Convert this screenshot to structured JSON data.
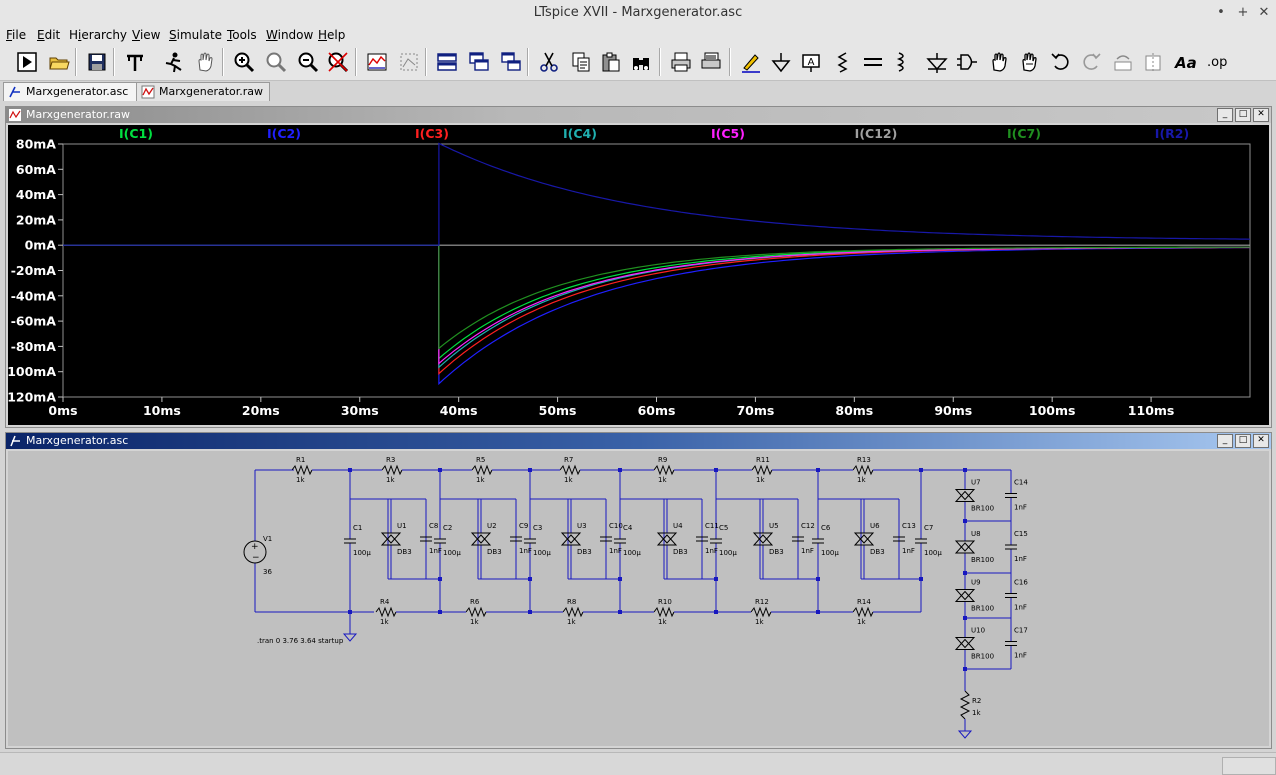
{
  "window": {
    "title": "LTspice XVII - Marxgenerator.asc",
    "controls": [
      "•",
      "+",
      "✕"
    ]
  },
  "menu": [
    "File",
    "Edit",
    "Hierarchy",
    "View",
    "Simulate",
    "Tools",
    "Window",
    "Help"
  ],
  "menu_mnemonics": [
    "F",
    "E",
    "i",
    "V",
    "S",
    "T",
    "W",
    "H"
  ],
  "toolbar": [
    "run-icon",
    "open-icon",
    "save-icon",
    "control-panel-icon",
    "halt-icon",
    "pan-hand-icon",
    "zoom-in-icon",
    "zoom-area-icon",
    "zoom-out-icon",
    "zoom-fit-icon",
    "autoscale-icon",
    "plot-settings-icon",
    "tile-horizontal-icon",
    "cascade-icon",
    "tile-vertical-icon",
    "cut-icon",
    "copy-icon",
    "paste-icon",
    "find-icon",
    "print-icon",
    "print-preview-icon",
    "draw-wire-icon",
    "ground-icon",
    "label-net-icon",
    "resistor-icon",
    "capacitor-icon",
    "inductor-icon",
    "diode-icon",
    "component-icon",
    "move-icon",
    "drag-icon",
    "undo-icon",
    "redo-icon",
    "rotate-icon",
    "mirror-icon",
    "text-icon",
    "spice-directive-icon"
  ],
  "tabs": [
    {
      "label": "Marxgenerator.asc",
      "active": true
    },
    {
      "label": "Marxgenerator.raw",
      "active": false
    }
  ],
  "plot_window": {
    "title": "Marxgenerator.raw",
    "buttons": [
      "_",
      "□",
      "✕"
    ]
  },
  "schematic_window": {
    "title": "Marxgenerator.asc",
    "buttons": [
      "_",
      "□",
      "✕"
    ]
  },
  "chart_data": {
    "type": "line",
    "background": "#000000",
    "x_ticks": [
      "0ms",
      "10ms",
      "20ms",
      "30ms",
      "40ms",
      "50ms",
      "60ms",
      "70ms",
      "80ms",
      "90ms",
      "100ms",
      "110ms"
    ],
    "y_ticks": [
      "80mA",
      "60mA",
      "40mA",
      "20mA",
      "0mA",
      "-20mA",
      "-40mA",
      "-60mA",
      "-80mA",
      "-100mA",
      "-120mA"
    ],
    "xlim": [
      0,
      120
    ],
    "ylim": [
      -120,
      80
    ],
    "x_unit": "ms",
    "y_unit": "mA",
    "trigger_ms": 38,
    "series": [
      {
        "name": "I(C1)",
        "color": "#00e040",
        "start": -88,
        "tau": 13
      },
      {
        "name": "I(C2)",
        "color": "#2020ff",
        "start": -108,
        "tau": 15
      },
      {
        "name": "I(C3)",
        "color": "#ff2020",
        "start": -100,
        "tau": 14
      },
      {
        "name": "I(C4)",
        "color": "#20b0b0",
        "start": -95,
        "tau": 13.5
      },
      {
        "name": "I(C5)",
        "color": "#ff20ff",
        "start": -92,
        "tau": 13.5
      },
      {
        "name": "I(C12)",
        "color": "#a0a0a0",
        "start": 0,
        "tau": 10
      },
      {
        "name": "I(C7)",
        "color": "#209020",
        "start": -80,
        "tau": 12.5
      },
      {
        "name": "I(R2)",
        "color": "#1818a8",
        "start": 77,
        "tau": 20
      }
    ]
  },
  "schematic": {
    "directive": ".tran 0 3.76 3.64 startup",
    "source": {
      "name": "V1",
      "value": "36"
    },
    "top_resistors": [
      {
        "name": "R1",
        "value": "1k"
      },
      {
        "name": "R3",
        "value": "1k"
      },
      {
        "name": "R5",
        "value": "1k"
      },
      {
        "name": "R7",
        "value": "1k"
      },
      {
        "name": "R9",
        "value": "1k"
      },
      {
        "name": "R11",
        "value": "1k"
      },
      {
        "name": "R13",
        "value": "1k"
      }
    ],
    "bottom_resistors": [
      {
        "name": "R4",
        "value": "1k"
      },
      {
        "name": "R6",
        "value": "1k"
      },
      {
        "name": "R8",
        "value": "1k"
      },
      {
        "name": "R10",
        "value": "1k"
      },
      {
        "name": "R12",
        "value": "1k"
      },
      {
        "name": "R14",
        "value": "1k"
      }
    ],
    "main_caps": [
      {
        "name": "C1",
        "value": "100µ"
      },
      {
        "name": "C2",
        "value": "100µ"
      },
      {
        "name": "C3",
        "value": "100µ"
      },
      {
        "name": "C4",
        "value": "100µ"
      },
      {
        "name": "C5",
        "value": "100µ"
      },
      {
        "name": "C6",
        "value": "100µ"
      },
      {
        "name": "C7",
        "value": "100µ"
      }
    ],
    "diacs": [
      {
        "name": "U1",
        "value": "DB3",
        "cap": "C8",
        "cap_value": "1nF"
      },
      {
        "name": "U2",
        "value": "DB3",
        "cap": "C9",
        "cap_value": "1nF"
      },
      {
        "name": "U3",
        "value": "DB3",
        "cap": "C10",
        "cap_value": "1nF"
      },
      {
        "name": "U4",
        "value": "DB3",
        "cap": "C11",
        "cap_value": "1nF"
      },
      {
        "name": "U5",
        "value": "DB3",
        "cap": "C12",
        "cap_value": "1nF"
      },
      {
        "name": "U6",
        "value": "DB3",
        "cap": "C13",
        "cap_value": "1nF"
      }
    ],
    "output_stack": [
      {
        "name": "U7",
        "value": "BR100",
        "cap": "C14",
        "cap_value": "1nF"
      },
      {
        "name": "U8",
        "value": "BR100",
        "cap": "C15",
        "cap_value": "1nF"
      },
      {
        "name": "U9",
        "value": "BR100",
        "cap": "C16",
        "cap_value": "1nF"
      },
      {
        "name": "U10",
        "value": "BR100",
        "cap": "C17",
        "cap_value": "1nF"
      }
    ],
    "load": {
      "name": "R2",
      "value": "1k"
    }
  }
}
